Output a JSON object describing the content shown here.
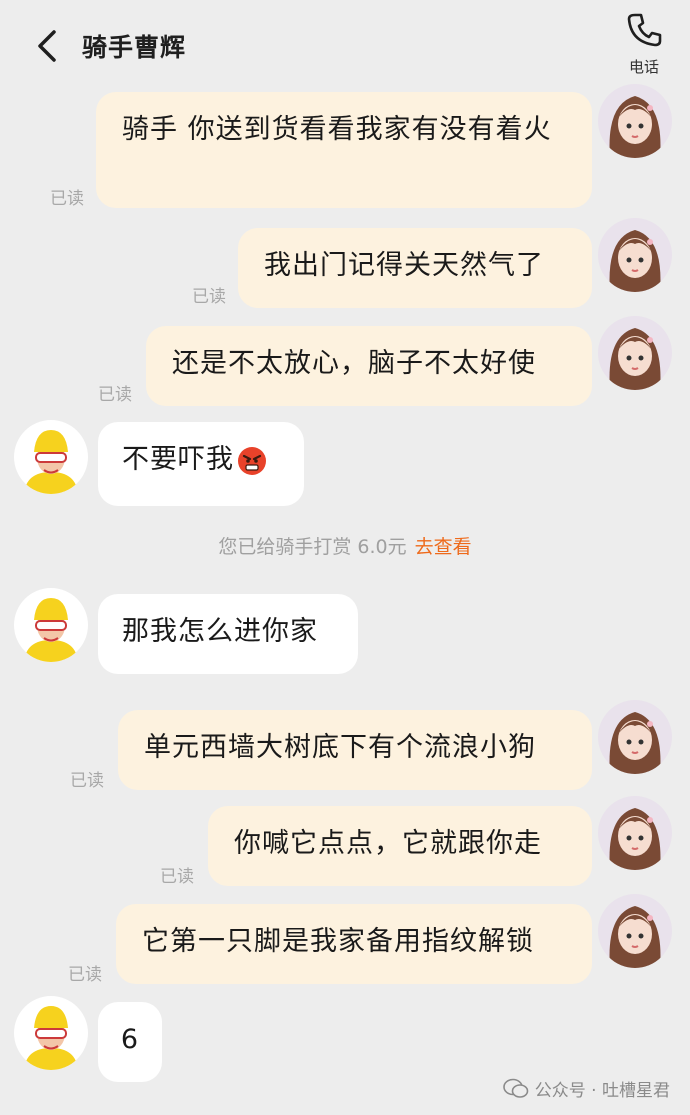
{
  "header": {
    "title": "骑手曹辉",
    "call_label": "电话"
  },
  "read_label": "已读",
  "messages": [
    {
      "text": "骑手 你送到货看看我家有没有着火"
    },
    {
      "text": "我出门记得关天然气了"
    },
    {
      "text": "还是不太放心，脑子不太好使"
    },
    {
      "text": "不要吓我"
    },
    {
      "text": "那我怎么进你家"
    },
    {
      "text": "单元西墙大树底下有个流浪小狗"
    },
    {
      "text": "你喊它点点，它就跟你走"
    },
    {
      "text": "它第一只脚是我家备用指纹解锁"
    },
    {
      "text": "6"
    }
  ],
  "system_notice": {
    "text": "您已给骑手打赏 6.0元",
    "link": "去查看"
  },
  "watermark": "公众号 · 吐槽星君",
  "colors": {
    "my_bubble": "#fdf2df",
    "other_bubble": "#ffffff",
    "background": "#ededed",
    "link": "#ee6a1b"
  }
}
